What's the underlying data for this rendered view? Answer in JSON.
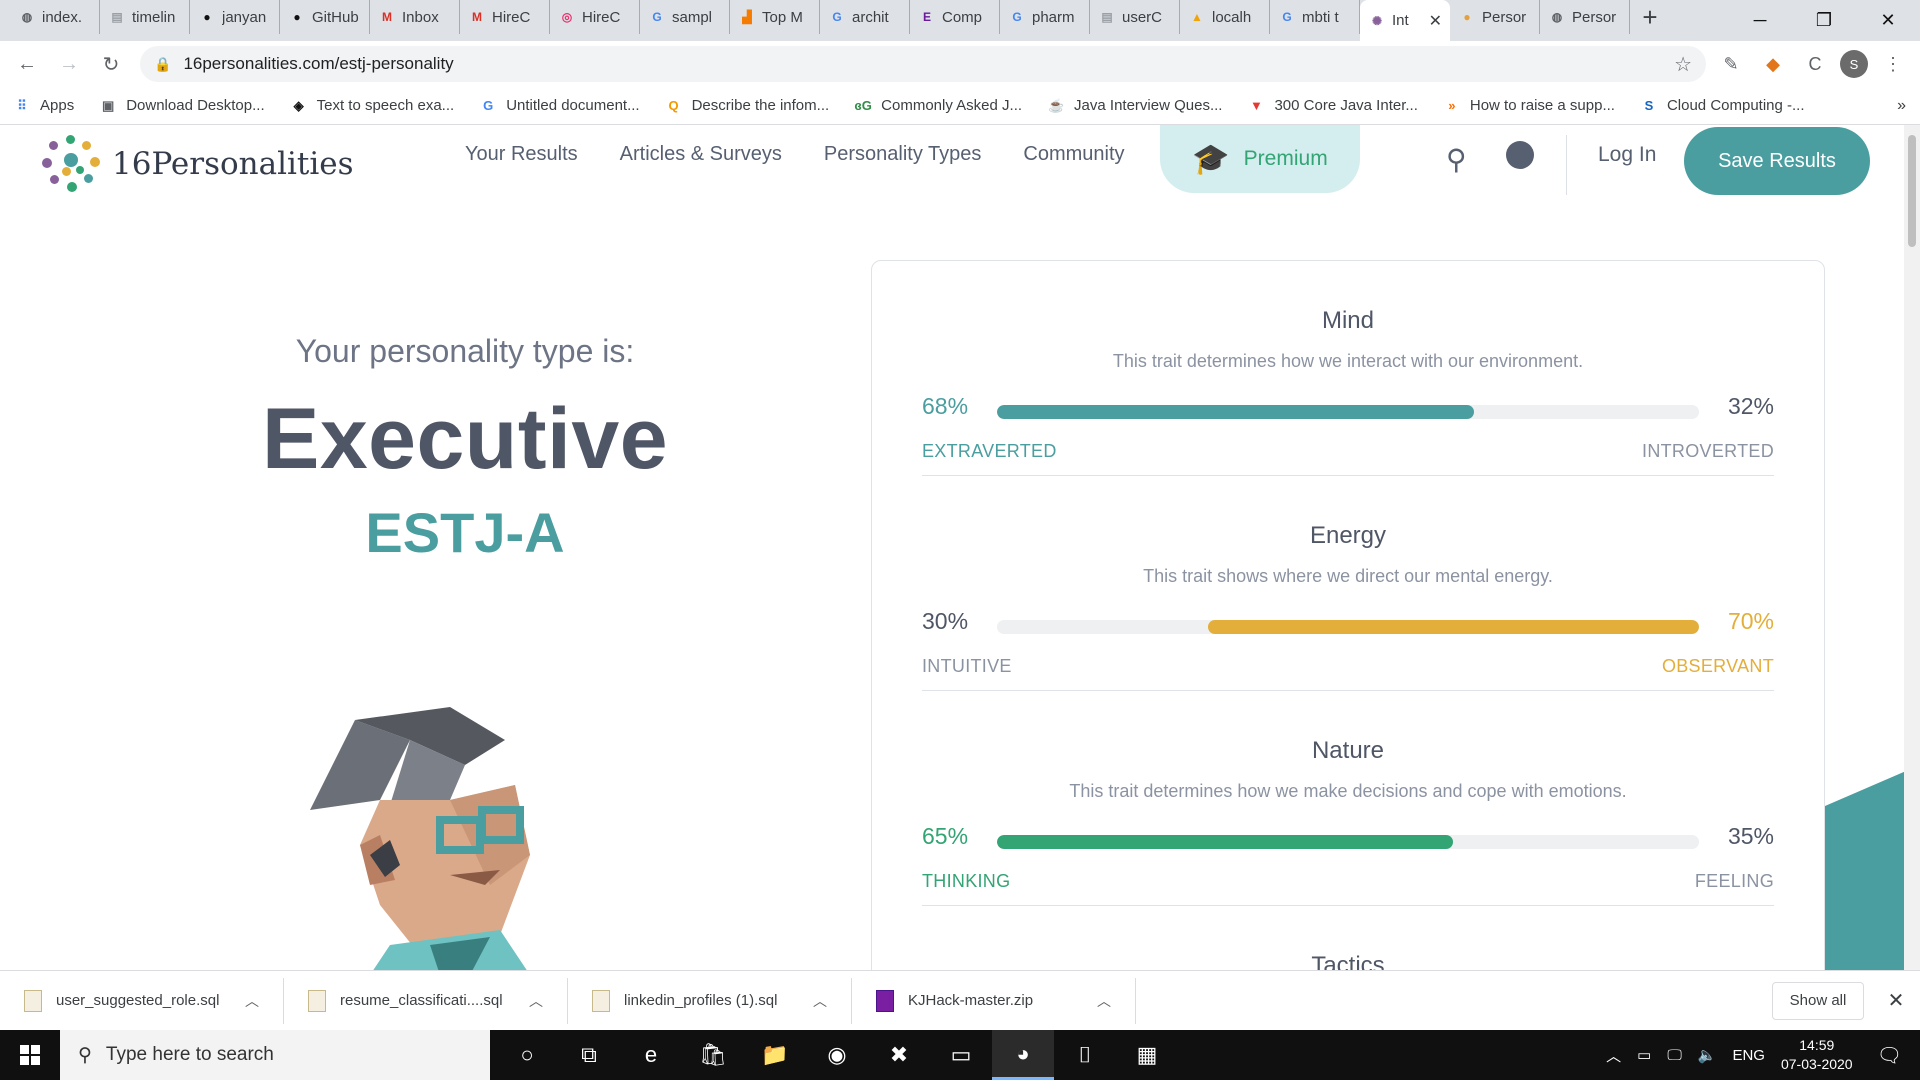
{
  "browser": {
    "tabs": [
      {
        "label": "index.",
        "icon": "globe-icon",
        "color": "#5f6368",
        "glyph": "◍"
      },
      {
        "label": "timelin",
        "icon": "doc-icon",
        "color": "#9aa0a6",
        "glyph": "▤"
      },
      {
        "label": "janyan",
        "icon": "github-icon",
        "color": "#111111",
        "glyph": "●"
      },
      {
        "label": "GitHub",
        "icon": "github-icon",
        "color": "#111111",
        "glyph": "●"
      },
      {
        "label": "Inbox",
        "icon": "gmail-icon",
        "color": "#d93025",
        "glyph": "M"
      },
      {
        "label": "HireC",
        "icon": "gmail-icon",
        "color": "#d93025",
        "glyph": "M"
      },
      {
        "label": "HireC",
        "icon": "hire-icon",
        "color": "#e8336d",
        "glyph": "◎"
      },
      {
        "label": "sampl",
        "icon": "google-icon",
        "color": "#4285f4",
        "glyph": "G"
      },
      {
        "label": "Top M",
        "icon": "chart-icon",
        "color": "#f57c00",
        "glyph": "▟"
      },
      {
        "label": "archit",
        "icon": "google-icon",
        "color": "#4285f4",
        "glyph": "G"
      },
      {
        "label": "Comp",
        "icon": "edureka-icon",
        "color": "#6a1b9a",
        "glyph": "E"
      },
      {
        "label": "pharm",
        "icon": "google-icon",
        "color": "#4285f4",
        "glyph": "G"
      },
      {
        "label": "userC",
        "icon": "doc-icon",
        "color": "#9aa0a6",
        "glyph": "▤"
      },
      {
        "label": "localh",
        "icon": "phpmyadmin-icon",
        "color": "#f0a30a",
        "glyph": "▲"
      },
      {
        "label": "mbti t",
        "icon": "google-icon",
        "color": "#4285f4",
        "glyph": "G"
      },
      {
        "label": "Int",
        "icon": "16p-icon",
        "color": "#88619a",
        "glyph": "✺",
        "active": true
      },
      {
        "label": "Persor",
        "icon": "bulb-icon",
        "color": "#e2a03f",
        "glyph": "●"
      },
      {
        "label": "Persor",
        "icon": "globe-icon",
        "color": "#5f6368",
        "glyph": "◍"
      }
    ],
    "new_tab": "+",
    "window_controls": {
      "minimize": "─",
      "maximize": "❐",
      "close": "✕"
    },
    "url": "16personalities.com/estj-personality",
    "profile_initial": "S",
    "bookmarks": [
      {
        "label": "Apps",
        "icon": "apps-grid-icon",
        "glyph": "⠿",
        "color": "#4285f4"
      },
      {
        "label": "Download Desktop...",
        "icon": "image-icon",
        "glyph": "▣",
        "color": "#5f6368"
      },
      {
        "label": "Text to speech exa...",
        "icon": "codepen-icon",
        "glyph": "◈",
        "color": "#111111"
      },
      {
        "label": "Untitled document...",
        "icon": "google-icon",
        "glyph": "G",
        "color": "#4285f4"
      },
      {
        "label": "Describe the infom...",
        "icon": "quora-q-icon",
        "glyph": "Q",
        "color": "#f29900"
      },
      {
        "label": "Commonly Asked J...",
        "icon": "gfg-icon",
        "glyph": "ɞG",
        "color": "#2f8d46"
      },
      {
        "label": "Java Interview Ques...",
        "icon": "java-icon",
        "glyph": "☕",
        "color": "#1e88e5"
      },
      {
        "label": "300 Core Java Inter...",
        "icon": "v-logo-icon",
        "glyph": "▼",
        "color": "#e53935"
      },
      {
        "label": "How to raise a supp...",
        "icon": "arrows-icon",
        "glyph": "»",
        "color": "#ff6d00"
      },
      {
        "label": "Cloud Computing -...",
        "icon": "s-logo-icon",
        "glyph": "S",
        "color": "#1565c0"
      }
    ],
    "bookmarks_more": "»"
  },
  "site": {
    "logo_text": "16Personalities",
    "nav": [
      "Your Results",
      "Articles & Surveys",
      "Personality Types",
      "Community"
    ],
    "premium_label": "Premium",
    "login_label": "Log In",
    "save_label": "Save Results",
    "colors": {
      "teal": "#4a9ea0",
      "green": "#33a474",
      "yellow": "#e4ae3a",
      "text": "#4f5666"
    }
  },
  "result": {
    "intro": "Your personality type is:",
    "type_name": "Executive",
    "type_code": "ESTJ-A"
  },
  "traits": [
    {
      "name": "Mind",
      "description": "This trait determines how we interact with our environment.",
      "left_pct": "68%",
      "right_pct": "32%",
      "left_label": "EXTRAVERTED",
      "right_label": "INTROVERTED",
      "value": 0.68,
      "side": "left",
      "color": "#4a9ea0"
    },
    {
      "name": "Energy",
      "description": "This trait shows where we direct our mental energy.",
      "left_pct": "30%",
      "right_pct": "70%",
      "left_label": "INTUITIVE",
      "right_label": "OBSERVANT",
      "value": 0.7,
      "side": "right",
      "color": "#e4ae3a"
    },
    {
      "name": "Nature",
      "description": "This trait determines how we make decisions and cope with emotions.",
      "left_pct": "65%",
      "right_pct": "35%",
      "left_label": "THINKING",
      "right_label": "FEELING",
      "value": 0.65,
      "side": "left",
      "color": "#33a474"
    },
    {
      "name": "Tactics",
      "description": "",
      "left_pct": "",
      "right_pct": "",
      "left_label": "",
      "right_label": "",
      "value": 0,
      "side": "left",
      "color": "#88619a"
    }
  ],
  "downloads": {
    "items": [
      "user_suggested_role.sql",
      "resume_classificati....sql",
      "linkedin_profiles (1).sql",
      "KJHack-master.zip"
    ],
    "show_all": "Show all",
    "close": "✕"
  },
  "taskbar": {
    "search_placeholder": "Type here to search",
    "apps": [
      {
        "name": "cortana-icon",
        "glyph": "○"
      },
      {
        "name": "task-view-icon",
        "glyph": "⧉"
      },
      {
        "name": "edge-icon",
        "glyph": "e"
      },
      {
        "name": "store-icon",
        "glyph": "🛍"
      },
      {
        "name": "file-explorer-icon",
        "glyph": "📁"
      },
      {
        "name": "safari-icon",
        "glyph": "◉"
      },
      {
        "name": "xampp-icon",
        "glyph": "✖"
      },
      {
        "name": "terminal-icon",
        "glyph": "▭"
      },
      {
        "name": "chrome-icon",
        "glyph": "◕",
        "active": true
      },
      {
        "name": "bracket-icon",
        "glyph": "⌷"
      },
      {
        "name": "winrar-icon",
        "glyph": "▦"
      }
    ],
    "tray_lang": "ENG",
    "time": "14:59",
    "date": "07-03-2020"
  }
}
